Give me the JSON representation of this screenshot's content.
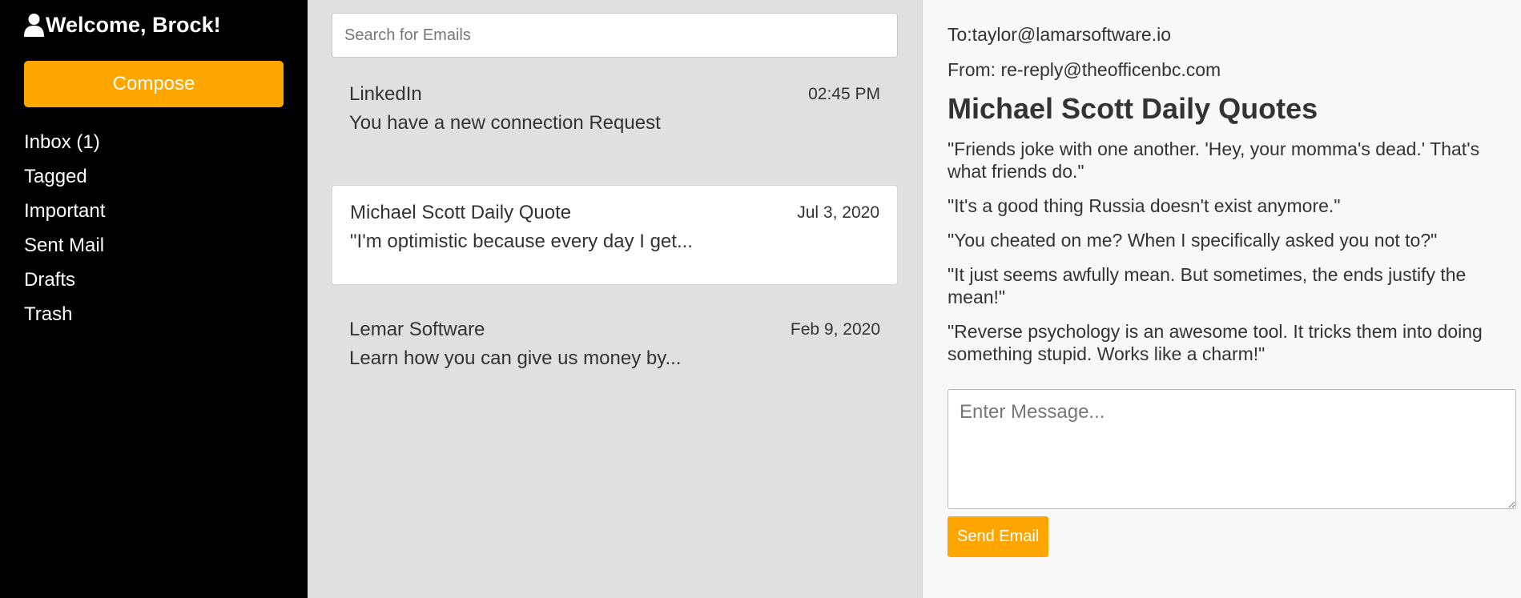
{
  "sidebar": {
    "welcome_text": "Welcome, Brock!",
    "user_icon": "user-icon",
    "compose_label": "Compose",
    "nav": [
      {
        "id": "inbox",
        "label": "Inbox (1)"
      },
      {
        "id": "tagged",
        "label": "Tagged"
      },
      {
        "id": "important",
        "label": "Important"
      },
      {
        "id": "sent-mail",
        "label": "Sent Mail"
      },
      {
        "id": "drafts",
        "label": "Drafts"
      },
      {
        "id": "trash",
        "label": "Trash"
      }
    ]
  },
  "search": {
    "placeholder": "Search for Emails",
    "value": ""
  },
  "emails": [
    {
      "sender": "LinkedIn",
      "date": "02:45 PM",
      "preview": "You have a new connection Request",
      "selected": false
    },
    {
      "sender": "Michael Scott Daily Quote",
      "date": "Jul 3, 2020",
      "preview": "\"I'm optimistic because every day I get...",
      "selected": true
    },
    {
      "sender": "Lemar Software",
      "date": "Feb 9, 2020",
      "preview": "Learn how you can give us money by...",
      "selected": false
    }
  ],
  "reader": {
    "to_line": "To:taylor@lamarsoftware.io",
    "from_line": "From: re-reply@theofficenbc.com",
    "subject": "Michael Scott Daily Quotes",
    "quotes": [
      "\"Friends joke with one another. 'Hey, your momma's dead.' That's what friends do.\"",
      "\"It's a good thing Russia doesn't exist anymore.\"",
      "\"You cheated on me? When I specifically asked you not to?\"",
      "\"It just seems awfully mean. But sometimes, the ends justify the mean!\"",
      "\"Reverse psychology is an awesome tool. It tricks them into doing something stupid. Works like a charm!\""
    ],
    "message_placeholder": "Enter Message...",
    "message_value": "",
    "send_label": "Send Email"
  },
  "colors": {
    "accent": "#ffa500",
    "sidebar_bg": "#000000",
    "list_bg": "#e0e0e0",
    "reader_bg": "#f8f8f8"
  }
}
